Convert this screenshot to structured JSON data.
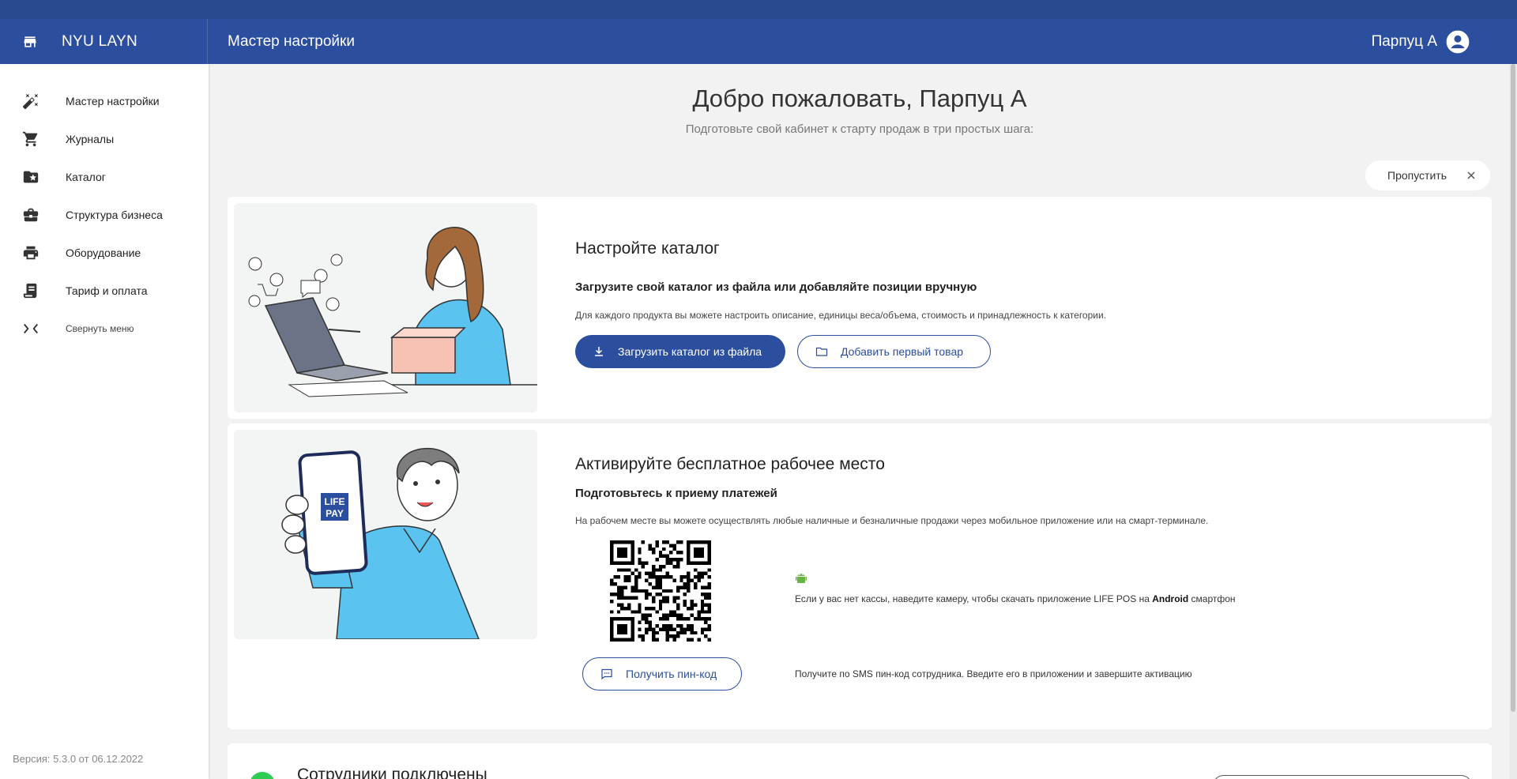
{
  "app": {
    "brand": "NYU LAYN",
    "page_title": "Мастер настройки",
    "user_name": "Парпуц А"
  },
  "sidebar": {
    "items": [
      {
        "label": "Мастер настройки",
        "icon": "magic-wand-icon"
      },
      {
        "label": "Журналы",
        "icon": "cart-icon"
      },
      {
        "label": "Каталог",
        "icon": "folder-star-icon"
      },
      {
        "label": "Структура бизнеса",
        "icon": "briefcase-icon"
      },
      {
        "label": "Оборудование",
        "icon": "printer-icon"
      },
      {
        "label": "Тариф и оплата",
        "icon": "receipt-icon"
      },
      {
        "label": "Свернуть меню",
        "icon": "collapse-icon"
      }
    ],
    "version": "Версия: 5.3.0 от 06.12.2022"
  },
  "main": {
    "welcome_title": "Добро пожаловать, Парпуц А",
    "welcome_subtitle": "Подготовьте свой кабинет к старту продаж в три простых шага:",
    "skip_label": "Пропустить"
  },
  "step1": {
    "title": "Настройте каталог",
    "subtitle": "Загрузите свой каталог из файла или добавляйте позиции вручную",
    "description": "Для каждого продукта вы можете настроить описание, единицы веса/объема, стоимость и принадлежность к категории.",
    "upload_button": "Загрузить каталог из файла",
    "add_button": "Добавить первый товар"
  },
  "step2": {
    "title": "Активируйте бесплатное рабочее место",
    "subtitle": "Подготовьтесь к приему платежей",
    "description": "На рабочем месте вы можете осуществлять любые наличные и безналичные продажи через мобильное приложение или на смарт-терминале.",
    "phone_logo": "LIFE PAY",
    "qr_text_before": "Если у вас нет кассы, наведите камеру, чтобы скачать приложение LIFE POS на ",
    "qr_text_bold": "Android",
    "qr_text_after": " смартфон",
    "pin_button": "Получить пин-код",
    "pin_text": "Получите по SMS пин-код сотрудника. Введите его в приложении и завершите активацию"
  },
  "step3": {
    "title": "Сотрудники подключены"
  },
  "colors": {
    "primary": "#2b4e9e",
    "header": "#2b4e9e",
    "background": "#f2f2f2",
    "illustration_blue": "#5bc3f0",
    "success_green": "#2ecc52"
  }
}
